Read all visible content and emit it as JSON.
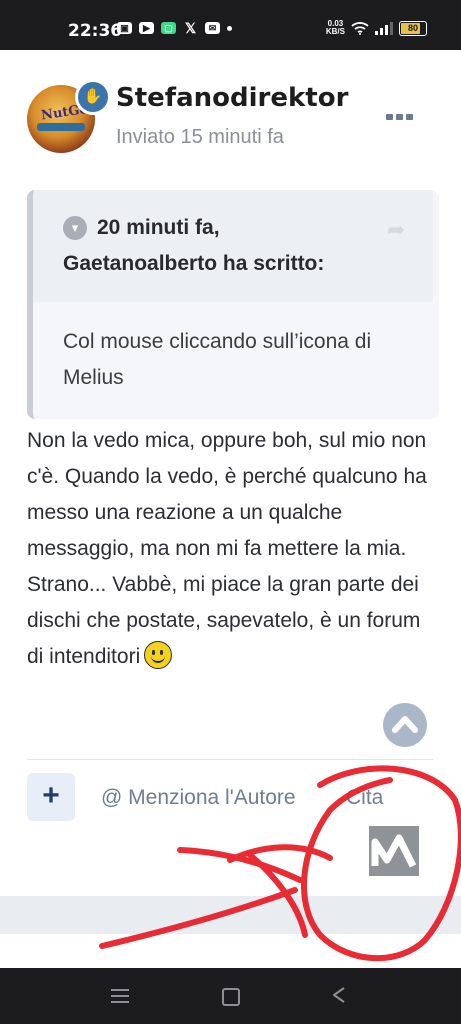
{
  "status_bar": {
    "time": "22:36",
    "network_speed_value": "0.03",
    "network_speed_unit": "KB/S",
    "battery": "80",
    "battery_level": 0.8
  },
  "post": {
    "author": "Stefanodirektor",
    "posted": "Inviato 15 minuti fa",
    "avatar_text": "NutGone",
    "quote": {
      "time": "20 minuti fa,",
      "author_line": "Gaetanoalberto ha scritto:",
      "text": "Col mouse cliccando sull’icona di Melius"
    },
    "body": "Non la vedo mica, oppure boh, sul mio non c'è. Quando la vedo, è perché qualcuno ha messo una reazione a un qualche messaggio, ma non mi fa mettere la mia. Strano... Vabbè, mi piace la gran parte dei dischi che postate, sapevatelo, è un forum di intenditori"
  },
  "actions": {
    "add": "+",
    "mention": "@ Menziona l'Autore",
    "quote": "Cita"
  },
  "colors": {
    "accent": "#3b74ad",
    "annotation": "#e8202a"
  },
  "icons": [
    "hand-icon",
    "more-icon",
    "chevron-down-icon",
    "share-icon",
    "smiley-icon",
    "arrow-up-icon",
    "melius-logo-icon"
  ]
}
